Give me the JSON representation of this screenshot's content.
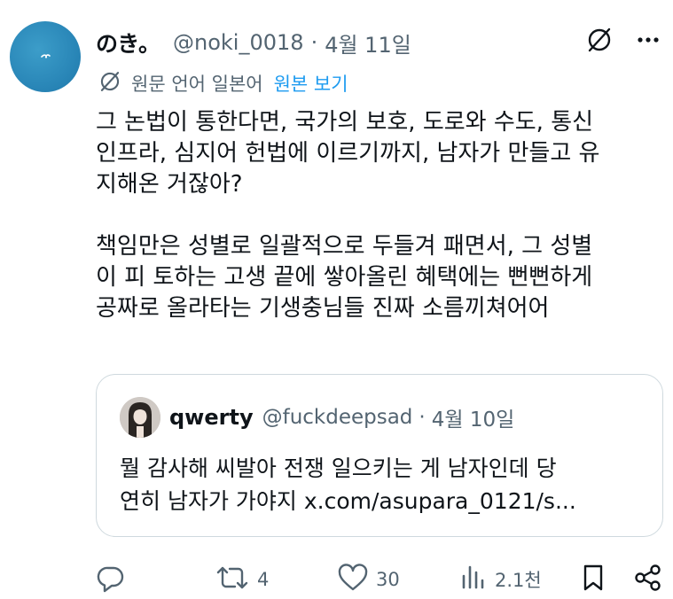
{
  "author": {
    "name": "のき。",
    "handle": "@noki_0018",
    "separator": "·",
    "date": "4월 11일"
  },
  "translate": {
    "label": "원문 언어 일본어",
    "link": "원본 보기"
  },
  "body": {
    "lines": [
      "그 논법이 통한다면, 국가의 보호, 도로와 수도, 통신",
      "인프라, 심지어 헌법에 이르기까지, 남자가 만들고 유",
      "지해온 거잖아?",
      "",
      "책임만은 성별로 일괄적으로 두들겨 패면서, 그 성별",
      "이 피 토하는 고생 끝에 쌓아올린 혜택에는 뻔뻔하게",
      "공짜로 올라타는 기생충님들 진짜 소름끼쳐어어"
    ]
  },
  "quote": {
    "name": "qwerty",
    "handle": "@fuckdeepsad",
    "separator": "·",
    "date": "4월 10일",
    "line1": "뭘 감사해 씨발아 전쟁 일으키는 게 남자인데 당",
    "line2_text": "연히 남자가 가야지 ",
    "line2_link": "x.com/asupara_0121/s..."
  },
  "actions": {
    "reply_count": "",
    "retweet_count": "4",
    "like_count": "30",
    "views_count": "2.1천"
  },
  "icons": {
    "translate": "translate-icon",
    "more": "more-icon",
    "reply": "reply-icon",
    "retweet": "retweet-icon",
    "like": "like-icon",
    "views": "views-icon",
    "bookmark": "bookmark-icon",
    "share": "share-icon"
  },
  "colors": {
    "text": "#0f1419",
    "muted": "#536471",
    "link": "#1d9bf0",
    "border": "#cfd9de"
  }
}
